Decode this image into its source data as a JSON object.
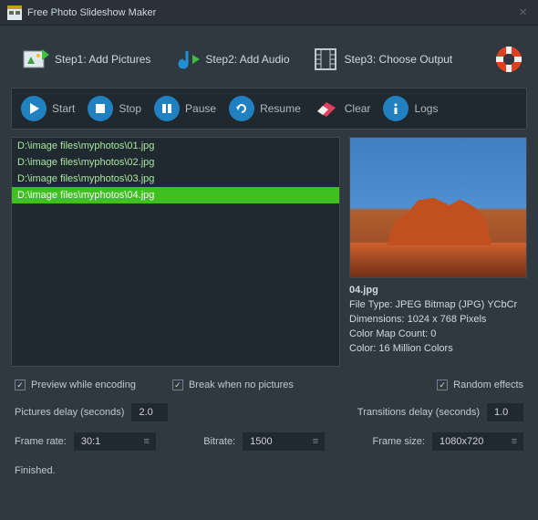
{
  "title": "Free Photo Slideshow Maker",
  "steps": [
    {
      "label": "Step1: Add Pictures"
    },
    {
      "label": "Step2: Add Audio"
    },
    {
      "label": "Step3: Choose Output"
    }
  ],
  "actions": {
    "start": "Start",
    "stop": "Stop",
    "pause": "Pause",
    "resume": "Resume",
    "clear": "Clear",
    "logs": "Logs"
  },
  "files": [
    "D:\\image files\\myphotos\\01.jpg",
    "D:\\image files\\myphotos\\02.jpg",
    "D:\\image files\\myphotos\\03.jpg",
    "D:\\image files\\myphotos\\04.jpg"
  ],
  "selectedIndex": 3,
  "preview": {
    "filename": "04.jpg",
    "filetype": "File Type: JPEG Bitmap (JPG) YCbCr",
    "dimensions": "Dimensions: 1024 x 768 Pixels",
    "colormap": "Color Map Count: 0",
    "color": "Color: 16 Million Colors"
  },
  "checks": {
    "preview": "Preview while encoding",
    "break": "Break when no pictures",
    "random": "Random effects"
  },
  "delays": {
    "picturesLabel": "Pictures delay (seconds)",
    "picturesValue": "2.0",
    "transitionsLabel": "Transitions delay (seconds)",
    "transitionsValue": "1.0"
  },
  "encoding": {
    "framerateLabel": "Frame rate:",
    "framerateValue": "30:1",
    "bitrateLabel": "Bitrate:",
    "bitrateValue": "1500",
    "framesizeLabel": "Frame size:",
    "framesizeValue": "1080x720"
  },
  "status": "Finished."
}
